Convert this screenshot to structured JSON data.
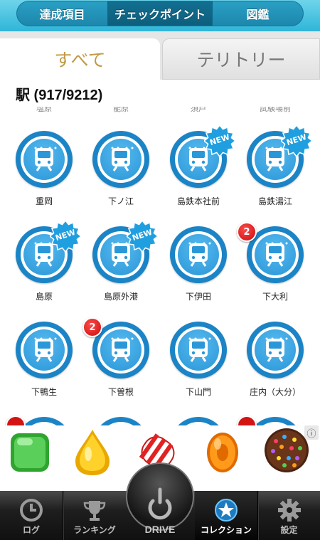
{
  "segment": {
    "left": "達成項目",
    "middle": "チェックポイント",
    "right": "図鑑"
  },
  "tabs": {
    "all": "すべて",
    "territory": "テリトリー"
  },
  "section": {
    "title": "駅 (917/9212)"
  },
  "clipped_row_labels": [
    "塩原",
    "能原",
    "須戸",
    "試験場前"
  ],
  "stations": [
    {
      "name": "重岡",
      "new": false,
      "count": null
    },
    {
      "name": "下ノ江",
      "new": false,
      "count": null
    },
    {
      "name": "島鉄本社前",
      "new": true,
      "count": null
    },
    {
      "name": "島鉄湯江",
      "new": true,
      "count": null
    },
    {
      "name": "島原",
      "new": true,
      "count": null
    },
    {
      "name": "島原外港",
      "new": true,
      "count": null
    },
    {
      "name": "下伊田",
      "new": false,
      "count": null
    },
    {
      "name": "下大利",
      "new": false,
      "count": "2"
    },
    {
      "name": "下鴨生",
      "new": false,
      "count": null
    },
    {
      "name": "下曽根",
      "new": false,
      "count": "2"
    },
    {
      "name": "下山門",
      "new": false,
      "count": null
    },
    {
      "name": "庄内（大分）",
      "new": false,
      "count": null
    }
  ],
  "new_label": "NEW",
  "ad": {
    "info_icon": "info-icon",
    "info_glyph": "ⓘ"
  },
  "tabbar": {
    "log": "ログ",
    "ranking": "ランキング",
    "drive": "DRIVE",
    "collection": "コレクション",
    "settings": "設定"
  },
  "colors": {
    "accent": "#2fb5d8",
    "badge_blue": "#1b84c6",
    "tab_all_text": "#c19a46",
    "count_red": "#d41313",
    "new_blue": "#1f9fe0"
  }
}
